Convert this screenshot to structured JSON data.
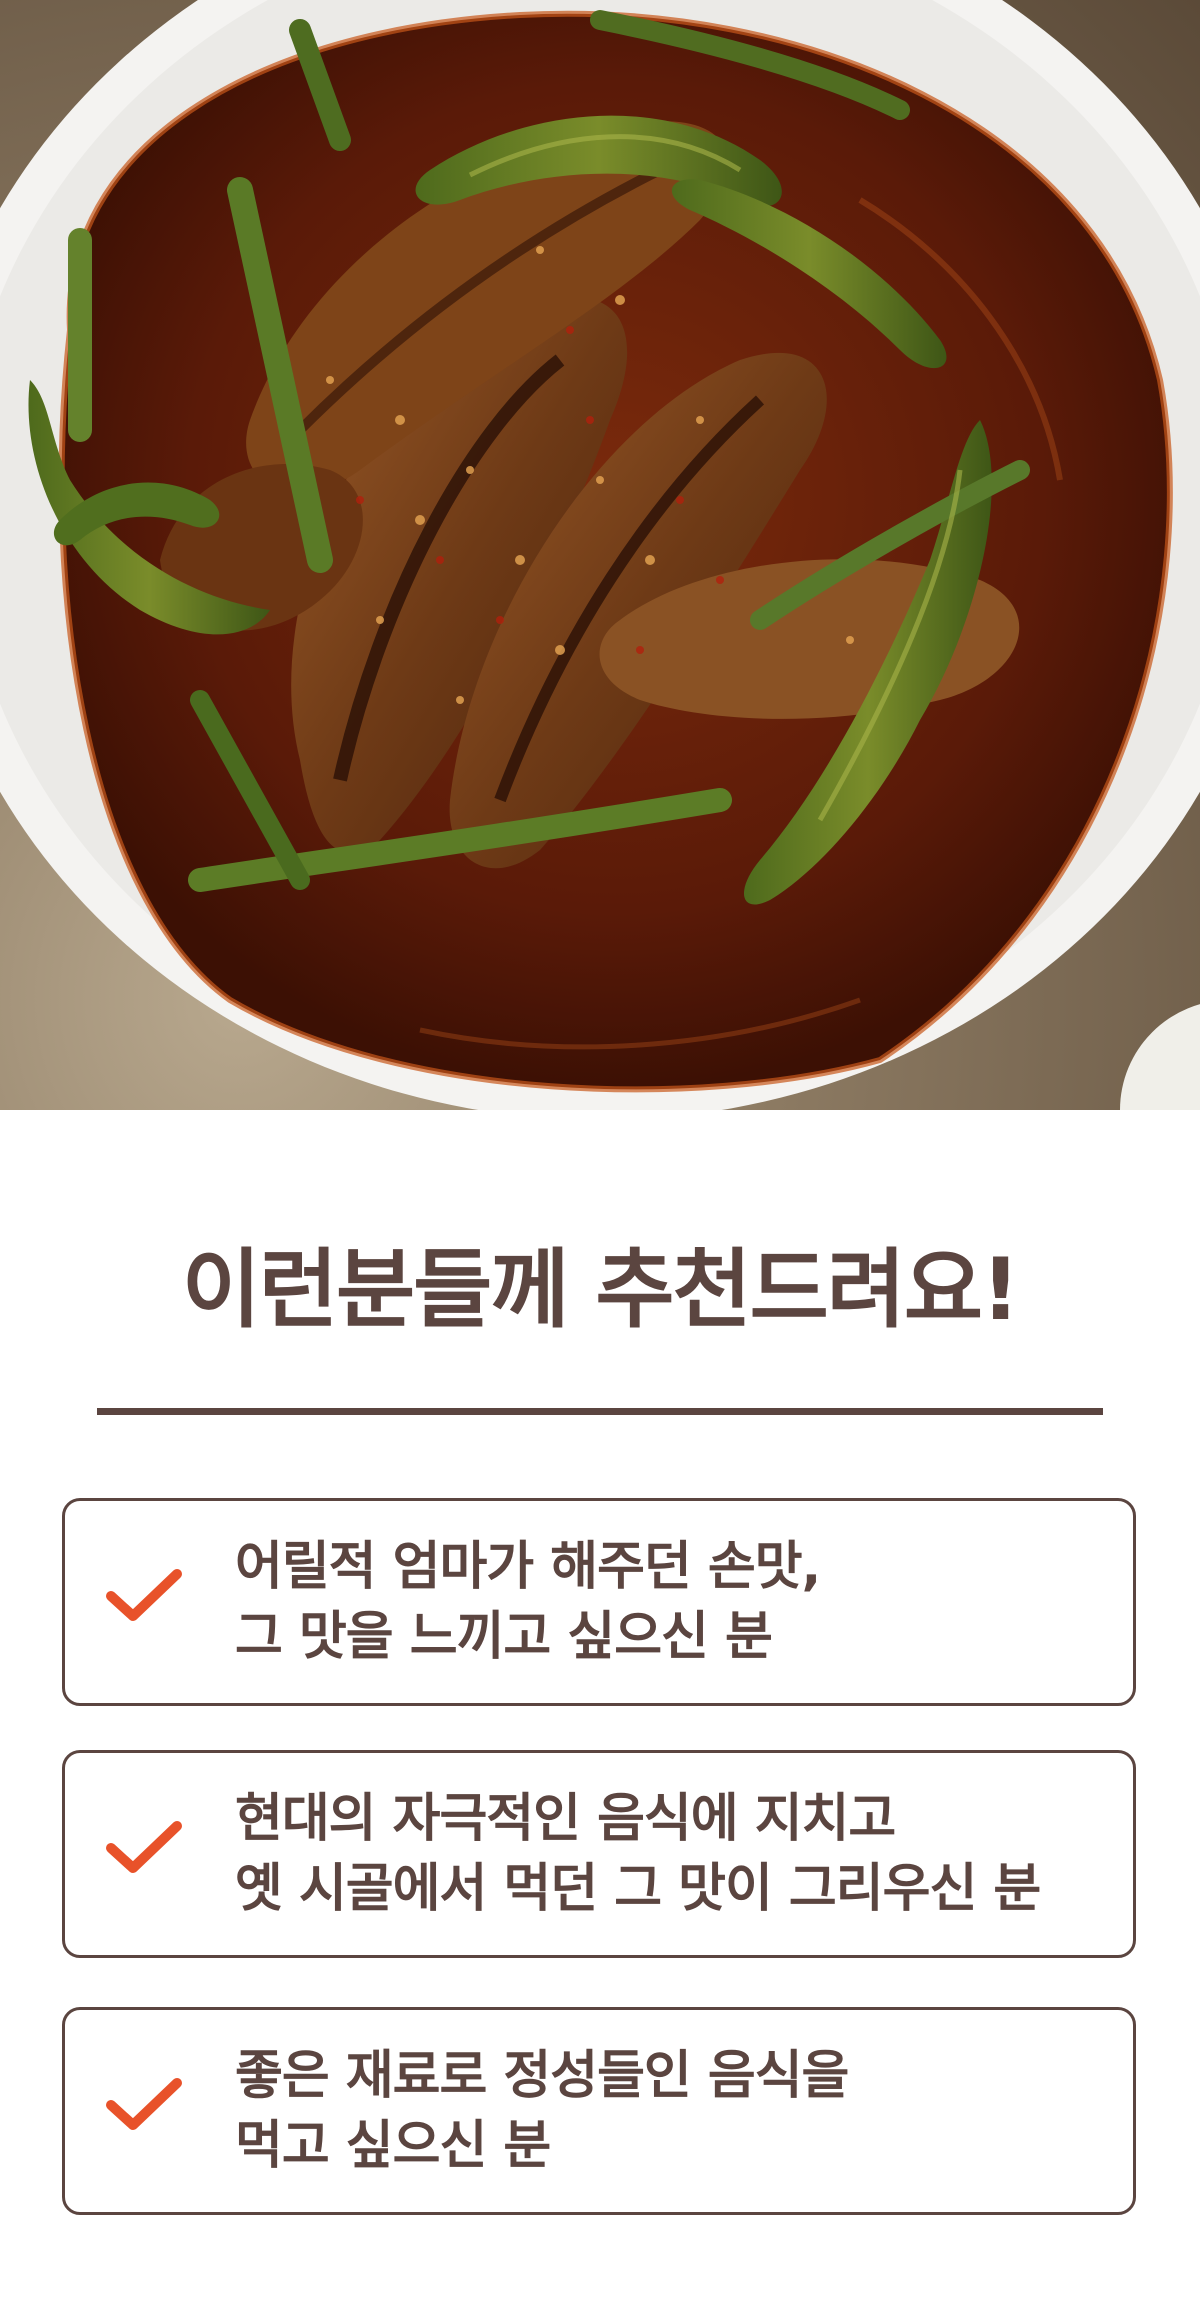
{
  "photo": {
    "subject": "braised fish with green chili peppers in red sauce on a white plate"
  },
  "heading": {
    "title": "이런분들께 추천드려요!"
  },
  "cards": [
    {
      "icon": "check-icon",
      "line1": "어릴적 엄마가 해주던 손맛,",
      "line2": "그 맛을 느끼고 싶으신 분"
    },
    {
      "icon": "check-icon",
      "line1": "현대의 자극적인 음식에 지치고",
      "line2": "옛 시골에서 먹던 그 맛이 그리우신 분"
    },
    {
      "icon": "check-icon",
      "line1": "좋은 재료로 정성들인 음식을",
      "line2": "먹고 싶으신 분"
    }
  ],
  "colors": {
    "text_brown": "#5b4540",
    "check_orange": "#e8522a",
    "sauce": "#5a1a08"
  }
}
